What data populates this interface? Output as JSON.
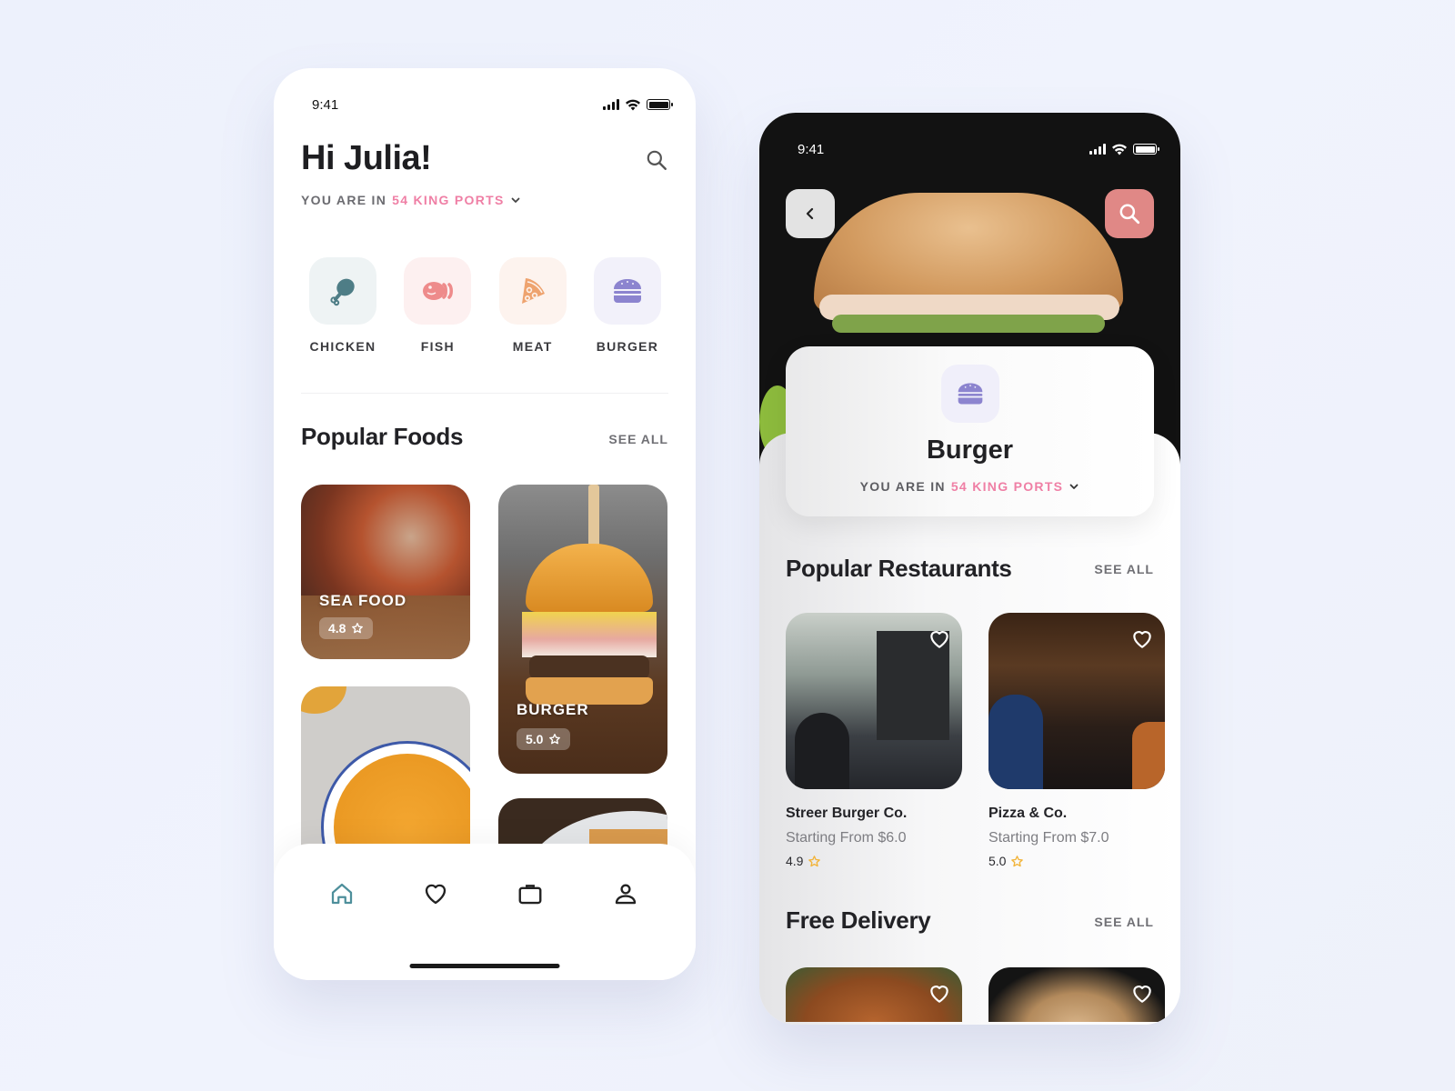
{
  "home_screen": {
    "status_bar": {
      "time": "9:41"
    },
    "greeting": "Hi Julia!",
    "location": {
      "prefix": "YOU ARE IN",
      "place": "54 KING PORTS"
    },
    "categories": [
      {
        "label": "CHICKEN",
        "icon": "chicken-leg-icon",
        "tile_color": "#eef3f4",
        "icon_color": "#4e7d86"
      },
      {
        "label": "FISH",
        "icon": "fish-icon",
        "tile_color": "#fdf0f0",
        "icon_color": "#ee8b8b"
      },
      {
        "label": "MEAT",
        "icon": "pizza-slice-icon",
        "tile_color": "#fdf3ee",
        "icon_color": "#eea36f"
      },
      {
        "label": "BURGER",
        "icon": "burger-icon",
        "tile_color": "#f2f1fa",
        "icon_color": "#8c84cf"
      }
    ],
    "popular_foods": {
      "title": "Popular Foods",
      "see_all": "SEE ALL",
      "items": [
        {
          "name": "SEA FOOD",
          "rating": "4.8"
        },
        {
          "name": "BURGER",
          "rating": "5.0"
        },
        {
          "name": "",
          "rating": ""
        },
        {
          "name": "",
          "rating": ""
        }
      ]
    },
    "tab_bar": [
      {
        "name": "home",
        "icon": "home-icon",
        "active": true
      },
      {
        "name": "favorites",
        "icon": "heart-icon",
        "active": false
      },
      {
        "name": "orders",
        "icon": "briefcase-icon",
        "active": false
      },
      {
        "name": "profile",
        "icon": "user-icon",
        "active": false
      }
    ],
    "accent_color": "#ef7fa5",
    "active_tab_color": "#4e8f9b"
  },
  "category_screen": {
    "status_bar": {
      "time": "9:41"
    },
    "category_title": "Burger",
    "location": {
      "prefix": "YOU ARE IN",
      "place": "54 KING PORTS"
    },
    "search_button_color": "#e08886",
    "popular_restaurants": {
      "title": "Popular Restaurants",
      "see_all": "SEE ALL",
      "items": [
        {
          "name": "Streer Burger Co.",
          "price": "Starting From $6.0",
          "rating": "4.9"
        },
        {
          "name": "Pizza & Co.",
          "price": "Starting From $7.0",
          "rating": "5.0"
        }
      ]
    },
    "free_delivery": {
      "title": "Free Delivery",
      "see_all": "SEE ALL"
    },
    "star_color": "#f2b43a"
  }
}
